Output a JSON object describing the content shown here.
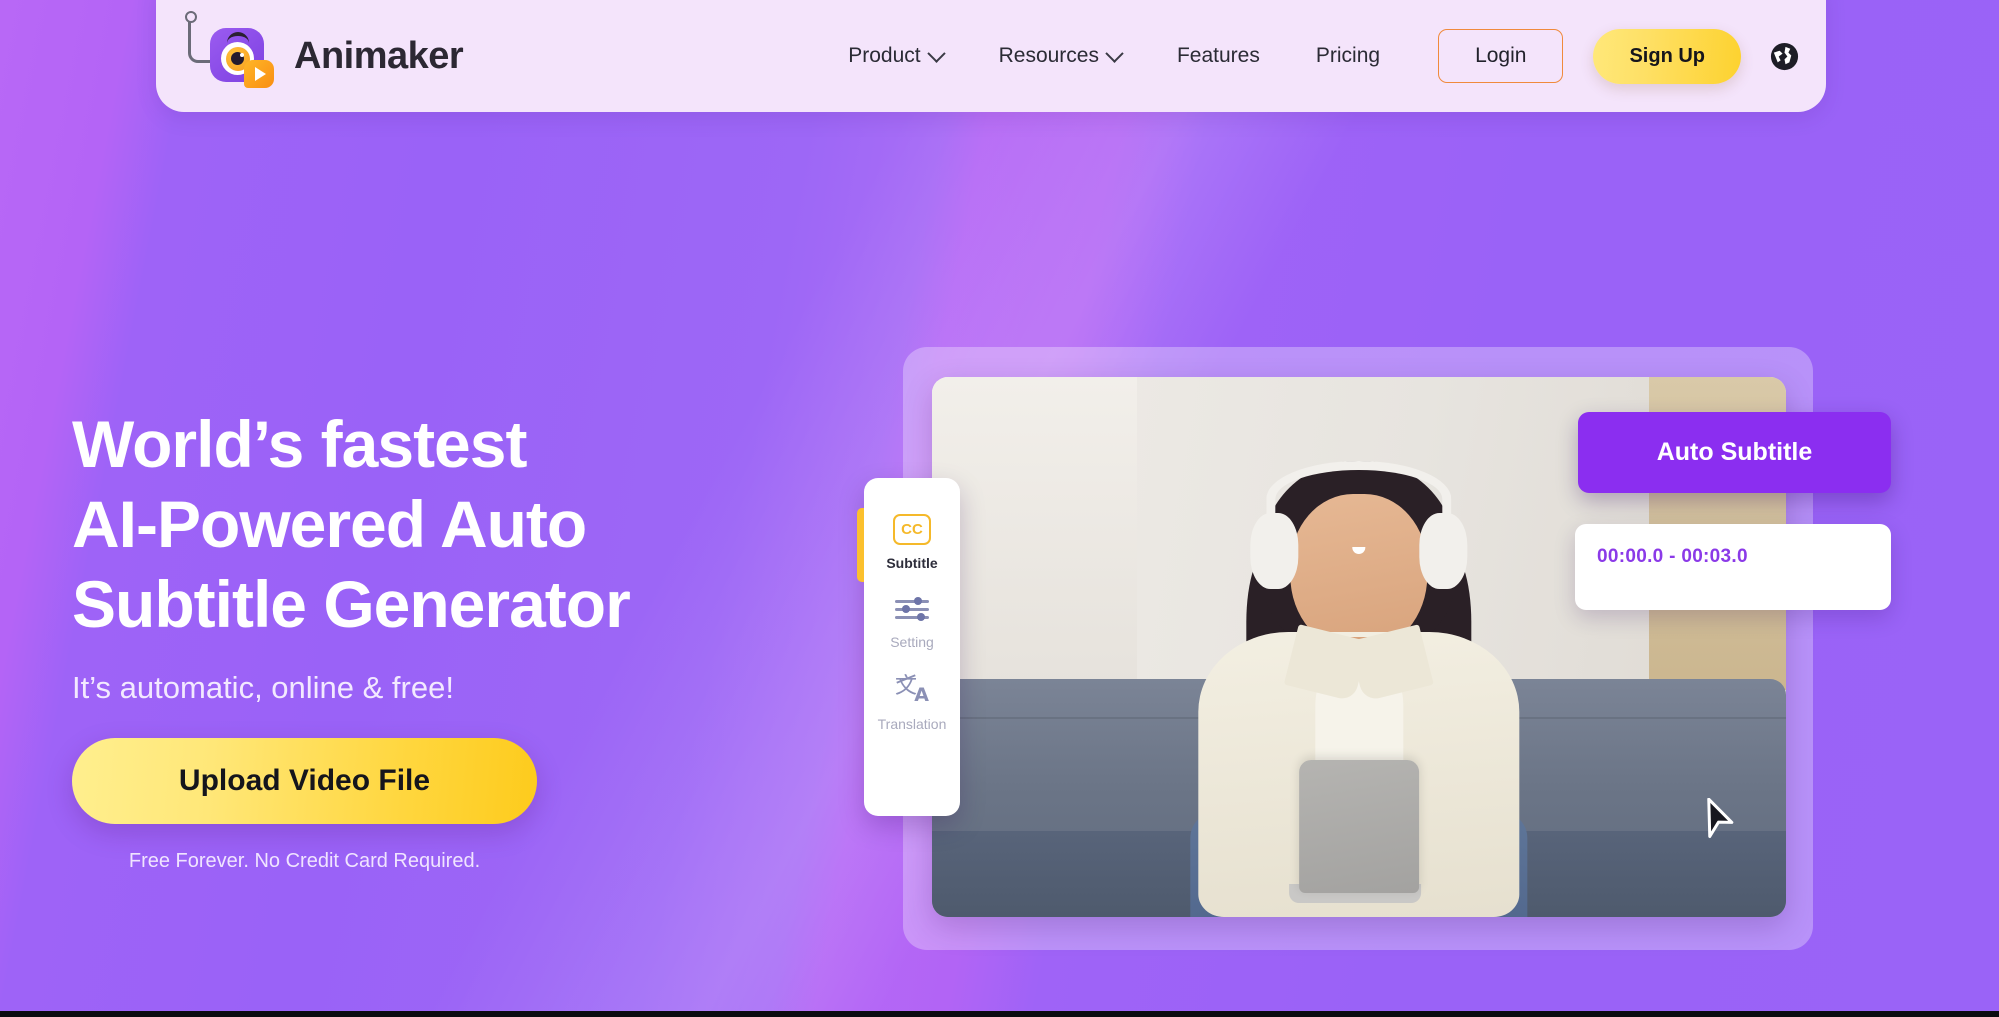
{
  "header": {
    "brand_name": "Animaker",
    "logo_icon": "animaker-camera-play-logo",
    "nav": [
      {
        "label": "Product",
        "has_dropdown": true,
        "icon": "chevron-down-icon"
      },
      {
        "label": "Resources",
        "has_dropdown": true,
        "icon": "chevron-down-icon"
      },
      {
        "label": "Features",
        "has_dropdown": false
      },
      {
        "label": "Pricing",
        "has_dropdown": false
      }
    ],
    "login_label": "Login",
    "signup_label": "Sign Up",
    "language_icon": "globe-icon",
    "colors": {
      "bar_bg": "#f4e4fb",
      "login_border": "#f08a3c",
      "signup_bg": "#fdd22f",
      "nav_text": "#2b2b35"
    }
  },
  "hero": {
    "headline_line1": "World’s fastest",
    "headline_line2": "AI-Powered Auto",
    "headline_line3": "Subtitle Generator",
    "subheadline": "It’s automatic, online & free!",
    "cta_label": "Upload Video File",
    "note": "Free Forever. No Credit Card Required.",
    "colors": {
      "headline": "#ffffff",
      "cta_bg": "#ffd63d",
      "cta_text": "#15151c",
      "bg_purple_a": "#b566f5",
      "bg_purple_b": "#9560f7"
    }
  },
  "preview": {
    "image_alt": "woman-with-headphones-using-laptop-on-sofa",
    "sidebar": {
      "items": [
        {
          "label": "Subtitle",
          "icon": "cc-icon",
          "active": true
        },
        {
          "label": "Setting",
          "icon": "sliders-icon",
          "active": false
        },
        {
          "label": "Translation",
          "icon": "translate-icon",
          "active": false
        }
      ]
    },
    "auto_subtitle_label": "Auto Subtitle",
    "timestamp": "00:00.0 - 00:03.0",
    "cursor_icon": "mouse-pointer-icon",
    "colors": {
      "auto_card_bg": "#8b2ef0",
      "timestamp_text": "#8b3ae8",
      "active_accent": "#fbc02d"
    }
  }
}
